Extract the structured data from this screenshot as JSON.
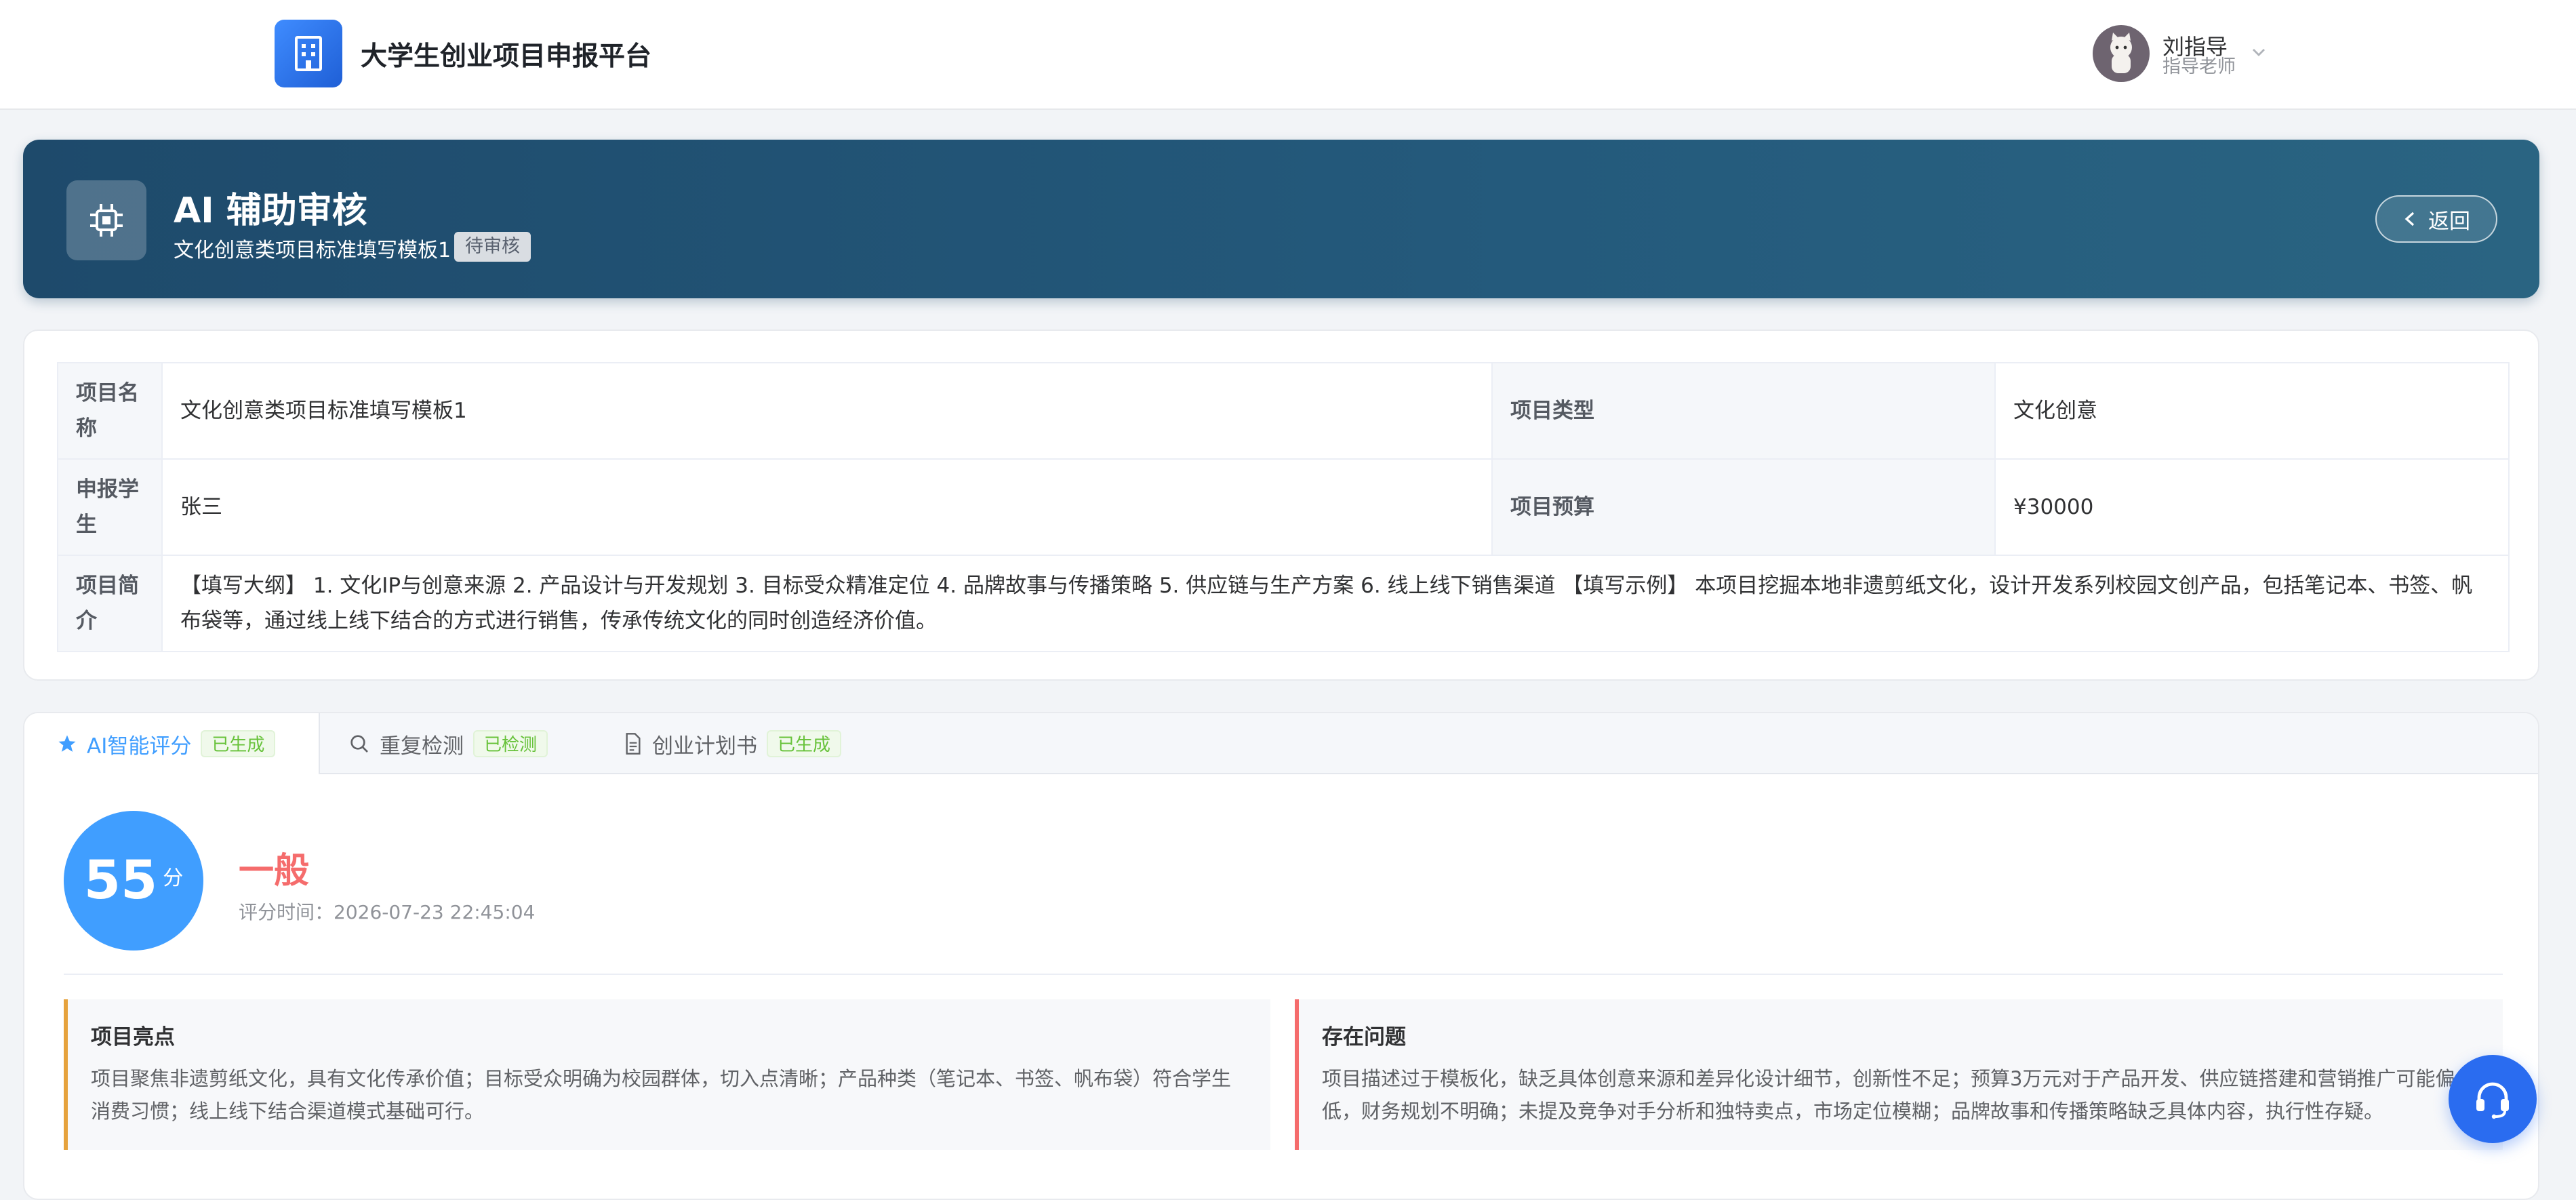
{
  "header": {
    "app_title": "大学生创业项目申报平台",
    "user": {
      "name": "刘指导",
      "role": "指导老师"
    }
  },
  "banner": {
    "title": "AI 辅助审核",
    "project_name": "文化创意类项目标准填写模板1",
    "status_badge": "待审核",
    "back_label": "返回"
  },
  "project_info": {
    "name_label": "项目名称",
    "name_value": "文化创意类项目标准填写模板1",
    "type_label": "项目类型",
    "type_value": "文化创意",
    "student_label": "申报学生",
    "student_value": "张三",
    "budget_label": "项目预算",
    "budget_value": "¥30000",
    "intro_label": "项目简介",
    "intro_value": "【填写大纲】 1. 文化IP与创意来源 2. 产品设计与开发规划 3. 目标受众精准定位 4. 品牌故事与传播策略 5. 供应链与生产方案 6. 线上线下销售渠道 【填写示例】 本项目挖掘本地非遗剪纸文化，设计开发系列校园文创产品，包括笔记本、书签、帆布袋等，通过线上线下结合的方式进行销售，传承传统文化的同时创造经济价值。"
  },
  "tabs": [
    {
      "label": "AI智能评分",
      "badge": "已生成",
      "icon": "star-icon",
      "active": true
    },
    {
      "label": "重复检测",
      "badge": "已检测",
      "icon": "search-icon",
      "active": false
    },
    {
      "label": "创业计划书",
      "badge": "已生成",
      "icon": "document-icon",
      "active": false
    }
  ],
  "score": {
    "value": "55",
    "unit": "分",
    "level": "一般",
    "time": "评分时间：2026-07-23 22:45:04"
  },
  "highlights": {
    "title": "项目亮点",
    "text": "项目聚焦非遗剪纸文化，具有文化传承价值；目标受众明确为校园群体，切入点清晰；产品种类（笔记本、书签、帆布袋）符合学生消费习惯；线上线下结合渠道模式基础可行。"
  },
  "issues": {
    "title": "存在问题",
    "text": "项目描述过于模板化，缺乏具体创意来源和差异化设计细节，创新性不足；预算3万元对于产品开发、供应链搭建和营销推广可能偏低，财务规划不明确；未提及竞争对手分析和独特卖点，市场定位模糊；品牌故事和传播策略缺乏具体内容，执行性存疑。"
  },
  "colors": {
    "accent": "#409eff",
    "banner": "#1e4a6b",
    "success": "#67c23a",
    "danger": "#f56c6c",
    "warning": "#e6a23c"
  }
}
